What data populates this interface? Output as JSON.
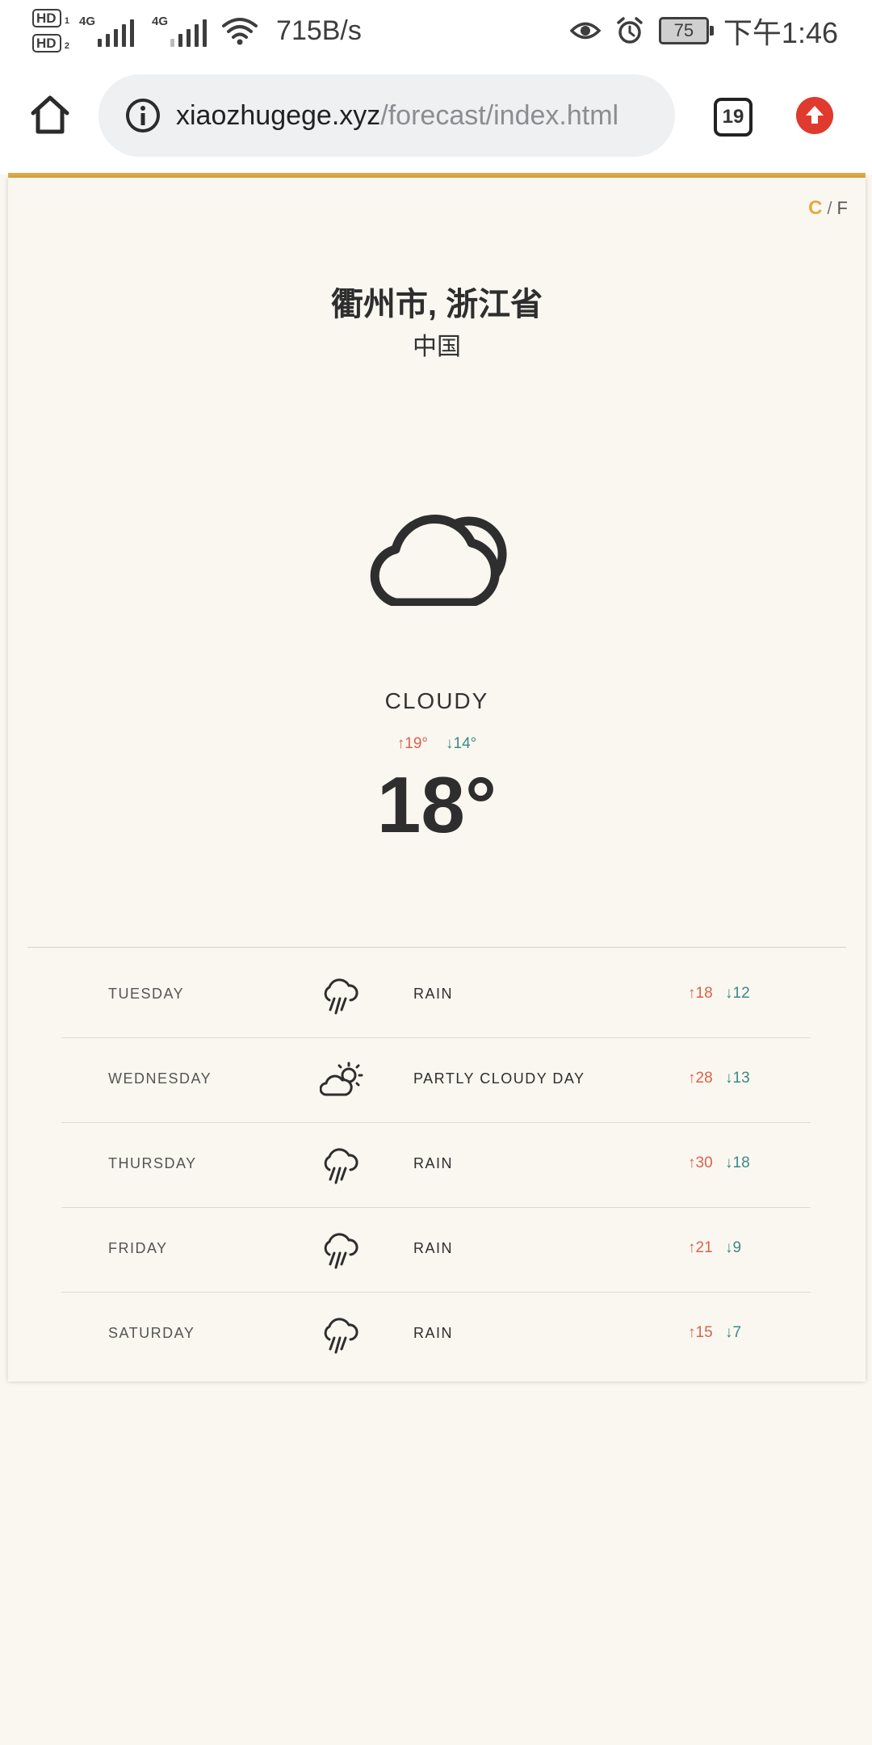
{
  "status_bar": {
    "sim1": "HD",
    "sim1_num": "1",
    "sim2": "HD",
    "sim2_num": "2",
    "net1": "4G",
    "net2": "4G",
    "speed": "715B/s",
    "battery": "75",
    "time": "下午1:46"
  },
  "browser": {
    "url_host": "xiaozhugege.xyz",
    "url_path": "/forecast/index.html",
    "tab_count": "19",
    "upload_color": "#e03a2f"
  },
  "weather": {
    "units": {
      "c": "C",
      "sep": "/",
      "f": "F"
    },
    "city": "衢州市, 浙江省",
    "country": "中国",
    "icon": "cloudy-icon",
    "condition": "CLOUDY",
    "high": "↑19°",
    "low": "↓14°",
    "temperature": "18°",
    "accent_color": "#e0aa45",
    "high_color": "#d9634a",
    "low_color": "#3a8a85"
  },
  "forecast": [
    {
      "day": "TUESDAY",
      "icon": "rain-icon",
      "condition": "RAIN",
      "high": "↑18",
      "low": "↓12"
    },
    {
      "day": "WEDNESDAY",
      "icon": "partly-cloudy-day-icon",
      "condition": "PARTLY CLOUDY DAY",
      "high": "↑28",
      "low": "↓13"
    },
    {
      "day": "THURSDAY",
      "icon": "rain-icon",
      "condition": "RAIN",
      "high": "↑30",
      "low": "↓18"
    },
    {
      "day": "FRIDAY",
      "icon": "rain-icon",
      "condition": "RAIN",
      "high": "↑21",
      "low": "↓9"
    },
    {
      "day": "SATURDAY",
      "icon": "rain-icon",
      "condition": "RAIN",
      "high": "↑15",
      "low": "↓7"
    }
  ]
}
